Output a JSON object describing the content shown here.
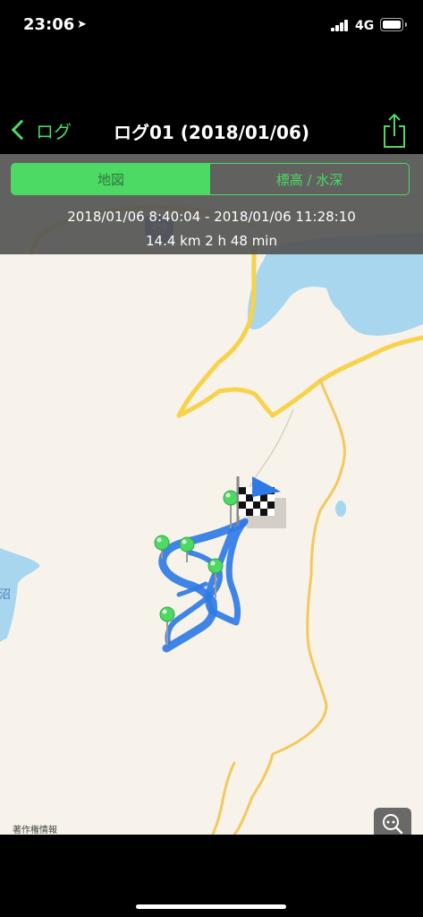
{
  "status_bar": {
    "time": "23:06",
    "network": "4G"
  },
  "nav": {
    "back_label": "ログ",
    "title": "ログ01 (2018/01/06)"
  },
  "segments": {
    "map": "地図",
    "elevation": "標高 / 水深"
  },
  "trip": {
    "time_range": "2018/01/06 8:40:04 - 2018/01/06 11:28:10",
    "stats": "14.4 km  2 h 48 min"
  },
  "map_labels": {
    "route_shield": "459",
    "place_fragment": "沼"
  },
  "attribution": "著作権情報",
  "colors": {
    "accent": "#4cd964",
    "track": "#2f7be6",
    "road": "#f7d24a",
    "water": "#a8d6ef"
  },
  "icons": [
    "location-arrow-icon",
    "back-chevron-icon",
    "share-icon",
    "finish-flag-icon",
    "green-pin-icon",
    "zoom-fit-icon"
  ]
}
